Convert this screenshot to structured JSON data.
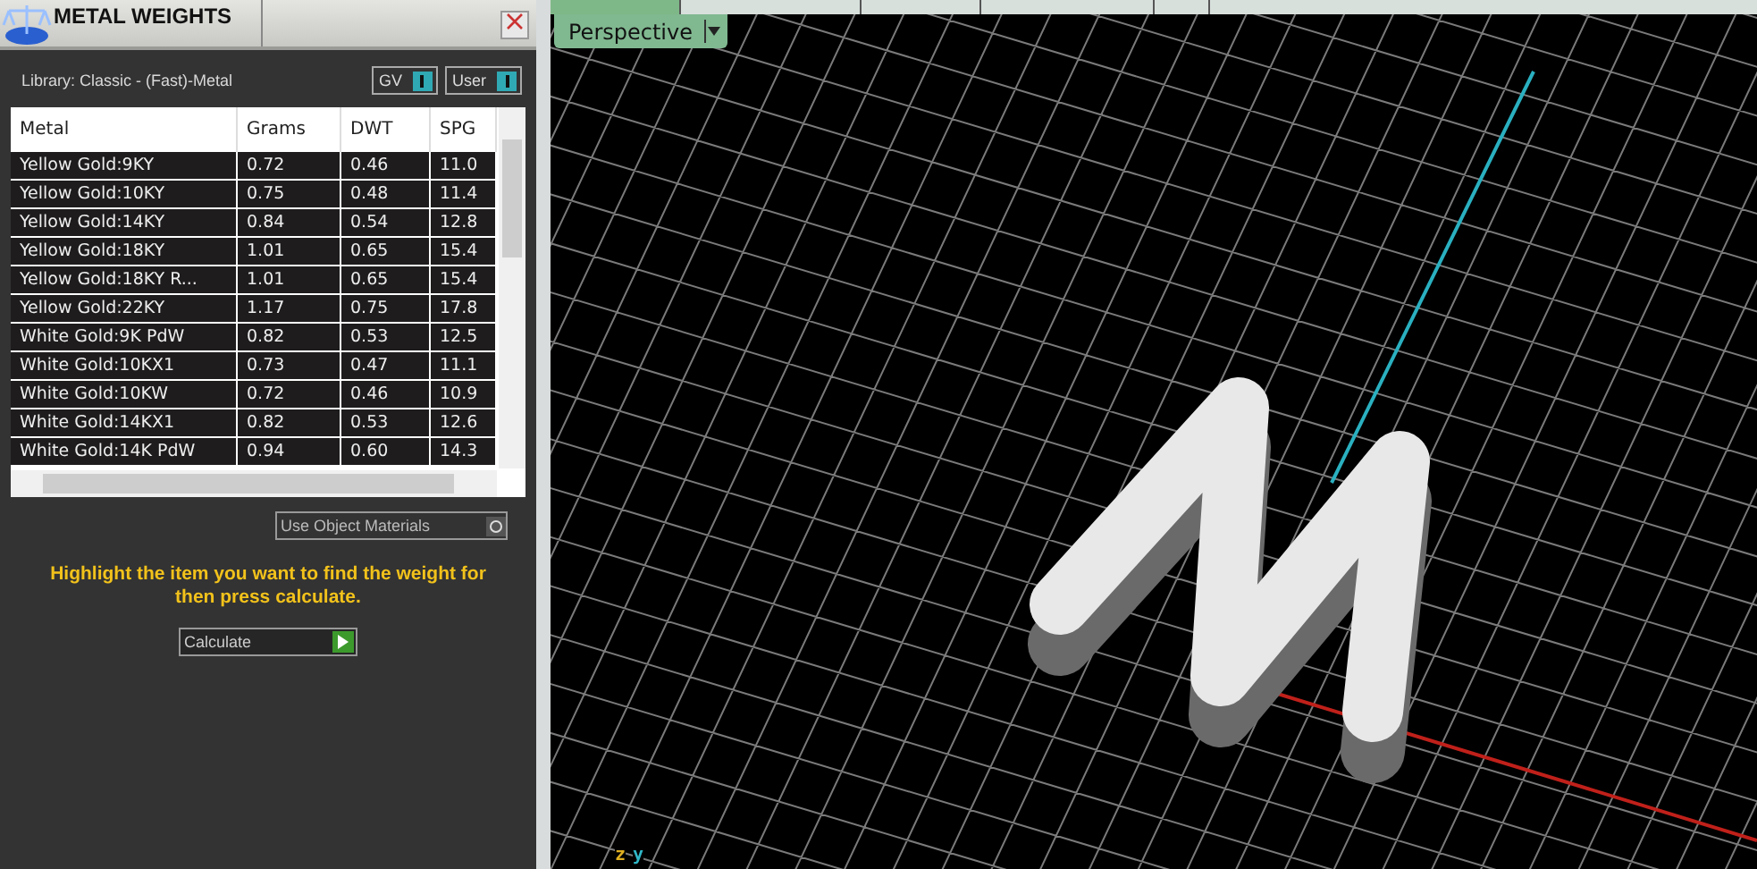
{
  "panel": {
    "title": "METAL WEIGHTS",
    "library": "Library: Classic - (Fast)-Metal",
    "toggles": [
      {
        "label": "GV",
        "on": true
      },
      {
        "label": "User",
        "on": true
      }
    ],
    "table": {
      "columns": [
        "Metal",
        "Grams",
        "DWT",
        "SPG"
      ],
      "rows": [
        [
          "Yellow Gold:9KY",
          "0.72",
          "0.46",
          "11.0"
        ],
        [
          "Yellow Gold:10KY",
          "0.75",
          "0.48",
          "11.4"
        ],
        [
          "Yellow Gold:14KY",
          "0.84",
          "0.54",
          "12.8"
        ],
        [
          "Yellow Gold:18KY",
          "1.01",
          "0.65",
          "15.4"
        ],
        [
          "Yellow Gold:18KY R...",
          "1.01",
          "0.65",
          "15.4"
        ],
        [
          "Yellow Gold:22KY",
          "1.17",
          "0.75",
          "17.8"
        ],
        [
          "White Gold:9K PdW",
          "0.82",
          "0.53",
          "12.5"
        ],
        [
          "White Gold:10KX1",
          "0.73",
          "0.47",
          "11.1"
        ],
        [
          "White Gold:10KW",
          "0.72",
          "0.46",
          "10.9"
        ],
        [
          "White Gold:14KX1",
          "0.82",
          "0.53",
          "12.6"
        ],
        [
          "White Gold:14K PdW",
          "0.94",
          "0.60",
          "14.3"
        ]
      ]
    },
    "use_object_materials": {
      "label": "Use Object Materials",
      "on": false
    },
    "hint": "Highlight the item you want to find the weight for then press calculate.",
    "calculate": "Calculate"
  },
  "viewport": {
    "view": "Perspective",
    "axis_labels": [
      "z",
      "y"
    ]
  }
}
